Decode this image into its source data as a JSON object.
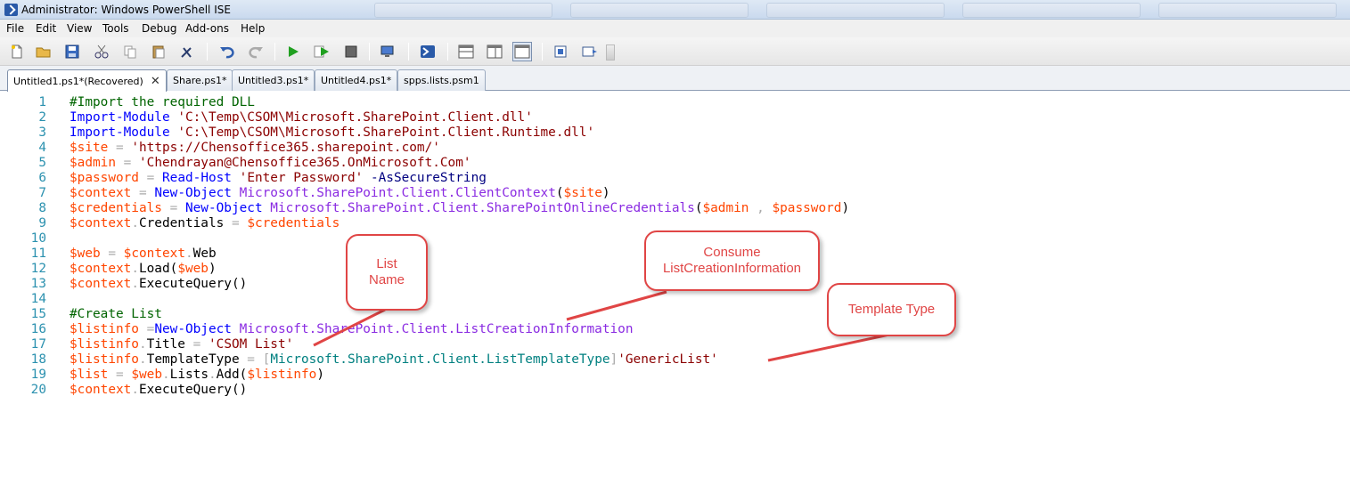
{
  "window": {
    "title": "Administrator: Windows PowerShell ISE"
  },
  "menu": [
    "File",
    "Edit",
    "View",
    "Tools",
    "Debug",
    "Add-ons",
    "Help"
  ],
  "toolbar": {
    "icons": [
      "new-file-icon",
      "open-folder-icon",
      "save-icon",
      "cut-icon",
      "copy-icon",
      "paste-icon",
      "clear-icon",
      "undo-icon",
      "redo-icon",
      "run-icon",
      "run-selection-icon",
      "stop-icon",
      "remote-tab-icon",
      "powershell-icon",
      "layout-top-icon",
      "layout-right-icon",
      "layout-max-icon",
      "show-script-pane-icon",
      "show-command-icon"
    ]
  },
  "tabs": [
    {
      "label": "Untitled1.ps1*(Recovered)",
      "active": true,
      "close": "✕"
    },
    {
      "label": "Share.ps1*"
    },
    {
      "label": "Untitled3.ps1*"
    },
    {
      "label": "Untitled4.ps1*"
    },
    {
      "label": "spps.lists.psm1"
    }
  ],
  "editor": {
    "lines": [
      {
        "n": "1",
        "tokens": [
          [
            "comment",
            "#Import the required DLL"
          ]
        ]
      },
      {
        "n": "2",
        "tokens": [
          [
            "cmd",
            "Import-Module"
          ],
          [
            "plain",
            " "
          ],
          [
            "str",
            "'C:\\Temp\\CSOM\\Microsoft.SharePoint.Client.dll'"
          ]
        ]
      },
      {
        "n": "3",
        "tokens": [
          [
            "cmd",
            "Import-Module"
          ],
          [
            "plain",
            " "
          ],
          [
            "str",
            "'C:\\Temp\\CSOM\\Microsoft.SharePoint.Client.Runtime.dll'"
          ]
        ]
      },
      {
        "n": "4",
        "tokens": [
          [
            "var",
            "$site"
          ],
          [
            "plain",
            " "
          ],
          [
            "op",
            "="
          ],
          [
            "plain",
            " "
          ],
          [
            "str",
            "'https://Chensoffice365.sharepoint.com/'"
          ]
        ]
      },
      {
        "n": "5",
        "tokens": [
          [
            "var",
            "$admin"
          ],
          [
            "plain",
            " "
          ],
          [
            "op",
            "="
          ],
          [
            "plain",
            " "
          ],
          [
            "str",
            "'Chendrayan@Chensoffice365.OnMicrosoft.Com'"
          ]
        ]
      },
      {
        "n": "6",
        "tokens": [
          [
            "var",
            "$password"
          ],
          [
            "plain",
            " "
          ],
          [
            "op",
            "="
          ],
          [
            "plain",
            " "
          ],
          [
            "cmd",
            "Read-Host"
          ],
          [
            "plain",
            " "
          ],
          [
            "str",
            "'Enter Password'"
          ],
          [
            "plain",
            " "
          ],
          [
            "param",
            "-AsSecureString"
          ]
        ]
      },
      {
        "n": "7",
        "tokens": [
          [
            "var",
            "$context"
          ],
          [
            "plain",
            " "
          ],
          [
            "op",
            "="
          ],
          [
            "plain",
            " "
          ],
          [
            "cmd",
            "New-Object"
          ],
          [
            "plain",
            " "
          ],
          [
            "arg",
            "Microsoft.SharePoint.Client.ClientContext"
          ],
          [
            "plain",
            "("
          ],
          [
            "var",
            "$site"
          ],
          [
            "plain",
            ")"
          ]
        ]
      },
      {
        "n": "8",
        "tokens": [
          [
            "var",
            "$credentials"
          ],
          [
            "plain",
            " "
          ],
          [
            "op",
            "="
          ],
          [
            "plain",
            " "
          ],
          [
            "cmd",
            "New-Object"
          ],
          [
            "plain",
            " "
          ],
          [
            "arg",
            "Microsoft.SharePoint.Client.SharePointOnlineCredentials"
          ],
          [
            "plain",
            "("
          ],
          [
            "var",
            "$admin"
          ],
          [
            "plain",
            " "
          ],
          [
            "op",
            ","
          ],
          [
            "plain",
            " "
          ],
          [
            "var",
            "$password"
          ],
          [
            "plain",
            ")"
          ]
        ]
      },
      {
        "n": "9",
        "tokens": [
          [
            "var",
            "$context"
          ],
          [
            "op",
            "."
          ],
          [
            "member",
            "Credentials"
          ],
          [
            "plain",
            " "
          ],
          [
            "op",
            "="
          ],
          [
            "plain",
            " "
          ],
          [
            "var",
            "$credentials"
          ]
        ]
      },
      {
        "n": "10",
        "tokens": []
      },
      {
        "n": "11",
        "tokens": [
          [
            "var",
            "$web"
          ],
          [
            "plain",
            " "
          ],
          [
            "op",
            "="
          ],
          [
            "plain",
            " "
          ],
          [
            "var",
            "$context"
          ],
          [
            "op",
            "."
          ],
          [
            "member",
            "Web"
          ]
        ]
      },
      {
        "n": "12",
        "tokens": [
          [
            "var",
            "$context"
          ],
          [
            "op",
            "."
          ],
          [
            "member",
            "Load"
          ],
          [
            "plain",
            "("
          ],
          [
            "var",
            "$web"
          ],
          [
            "plain",
            ")"
          ]
        ]
      },
      {
        "n": "13",
        "tokens": [
          [
            "var",
            "$context"
          ],
          [
            "op",
            "."
          ],
          [
            "member",
            "ExecuteQuery"
          ],
          [
            "plain",
            "()"
          ]
        ]
      },
      {
        "n": "14",
        "tokens": []
      },
      {
        "n": "15",
        "tokens": [
          [
            "comment",
            "#Create List"
          ]
        ]
      },
      {
        "n": "16",
        "tokens": [
          [
            "var",
            "$listinfo"
          ],
          [
            "plain",
            " "
          ],
          [
            "op",
            "="
          ],
          [
            "cmd",
            "New-Object"
          ],
          [
            "plain",
            " "
          ],
          [
            "arg",
            "Microsoft.SharePoint.Client.ListCreationInformation"
          ]
        ]
      },
      {
        "n": "17",
        "tokens": [
          [
            "var",
            "$listinfo"
          ],
          [
            "op",
            "."
          ],
          [
            "member",
            "Title"
          ],
          [
            "plain",
            " "
          ],
          [
            "op",
            "="
          ],
          [
            "plain",
            " "
          ],
          [
            "str",
            "'CSOM List'"
          ]
        ]
      },
      {
        "n": "18",
        "tokens": [
          [
            "var",
            "$listinfo"
          ],
          [
            "op",
            "."
          ],
          [
            "member",
            "TemplateType"
          ],
          [
            "plain",
            " "
          ],
          [
            "op",
            "="
          ],
          [
            "plain",
            " "
          ],
          [
            "op",
            "["
          ],
          [
            "type",
            "Microsoft.SharePoint.Client.ListTemplateType"
          ],
          [
            "op",
            "]"
          ],
          [
            "str",
            "'GenericList'"
          ]
        ]
      },
      {
        "n": "19",
        "tokens": [
          [
            "var",
            "$list"
          ],
          [
            "plain",
            " "
          ],
          [
            "op",
            "="
          ],
          [
            "plain",
            " "
          ],
          [
            "var",
            "$web"
          ],
          [
            "op",
            "."
          ],
          [
            "member",
            "Lists"
          ],
          [
            "op",
            "."
          ],
          [
            "member",
            "Add"
          ],
          [
            "plain",
            "("
          ],
          [
            "var",
            "$listinfo"
          ],
          [
            "plain",
            ")"
          ]
        ]
      },
      {
        "n": "20",
        "tokens": [
          [
            "var",
            "$context"
          ],
          [
            "op",
            "."
          ],
          [
            "member",
            "ExecuteQuery"
          ],
          [
            "plain",
            "()"
          ]
        ]
      }
    ]
  },
  "callouts": {
    "list_name": "List\nName",
    "consume": "Consume\nListCreationInformation",
    "template_type": "Template Type"
  },
  "colors": {
    "callout_red": "#e04545",
    "line_number": "#2b91af",
    "comment": "#006400",
    "command": "#0000ff",
    "string": "#8b0000",
    "variable": "#ff4500",
    "type": "#008080"
  }
}
